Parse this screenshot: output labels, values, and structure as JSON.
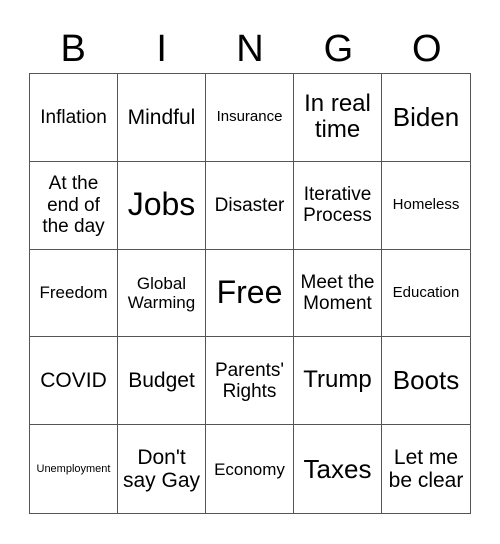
{
  "header": {
    "letters": [
      "B",
      "I",
      "N",
      "G",
      "O"
    ]
  },
  "cells": [
    [
      "Inflation",
      "Mindful",
      "Insurance",
      "In real time",
      "Biden"
    ],
    [
      "At the end of the day",
      "Jobs",
      "Disaster",
      "Iterative Process",
      "Homeless"
    ],
    [
      "Freedom",
      "Global Warming",
      "Free",
      "Meet the Moment",
      "Education"
    ],
    [
      "COVID",
      "Budget",
      "Parents' Rights",
      "Trump",
      "Boots"
    ],
    [
      "Unemployment",
      "Don't say Gay",
      "Economy",
      "Taxes",
      "Let me be clear"
    ]
  ]
}
